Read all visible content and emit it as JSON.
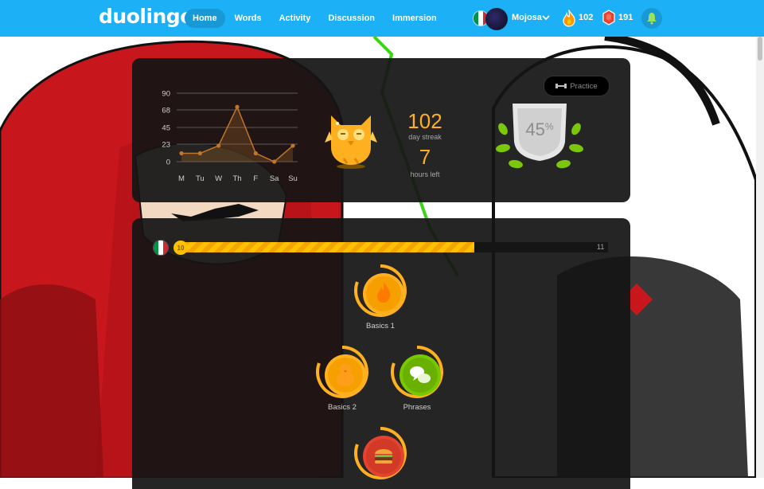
{
  "brand": {
    "logo_text": "duolingo"
  },
  "nav": {
    "items": [
      {
        "label": "Home",
        "active": true
      },
      {
        "label": "Words",
        "active": false
      },
      {
        "label": "Activity",
        "active": false
      },
      {
        "label": "Discussion",
        "active": false
      },
      {
        "label": "Immersion",
        "active": false
      }
    ]
  },
  "user": {
    "language_flag": "italian-flag-icon",
    "username": "Mojosa",
    "streak_count": "102",
    "gems_count": "191"
  },
  "colors": {
    "topbar": "#1cb0f6",
    "accent_gold": "#ffb020",
    "panel_bg": "#141414",
    "flag_green": "#009246",
    "flag_white": "#ffffff",
    "flag_red": "#ce2b37"
  },
  "streak_panel": {
    "streak_number": "102",
    "streak_label": "day streak",
    "hours_number": "7",
    "hours_label": "hours left",
    "practice_label": "Practice",
    "crown_percent": "45",
    "crown_percent_sign": "%"
  },
  "chart_data": {
    "type": "line",
    "categories": [
      "M",
      "Tu",
      "W",
      "Th",
      "F",
      "Sa",
      "Su"
    ],
    "values": [
      11,
      11,
      21,
      72,
      11,
      0,
      21
    ],
    "yticks": [
      0,
      23,
      45,
      68,
      90
    ],
    "ylim": [
      0,
      90
    ],
    "grid": true,
    "color": "#c0762a"
  },
  "course": {
    "level_current": "10",
    "level_next": "11",
    "progress_fraction": 0.69,
    "skills": [
      {
        "label": "Basics 1",
        "icon": "flame-icon",
        "color": "#ffb020"
      },
      {
        "label": "Basics 2",
        "icon": "chick-icon",
        "color": "#ffb020"
      },
      {
        "label": "Phrases",
        "icon": "speech-bubbles-icon",
        "color": "#78c800"
      },
      {
        "label": "",
        "icon": "burger-icon",
        "color": "#e5432f"
      }
    ]
  }
}
